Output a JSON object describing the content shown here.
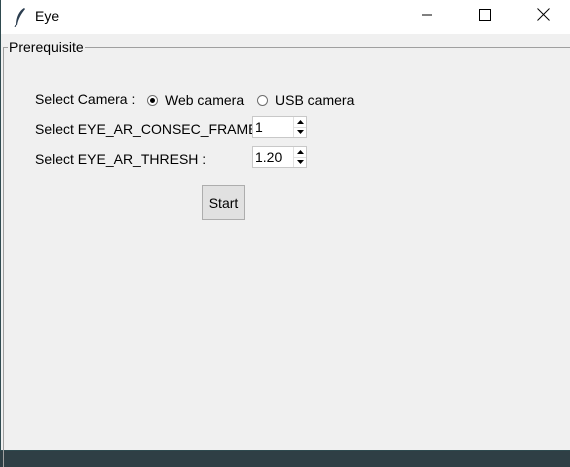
{
  "window": {
    "title": "Eye",
    "icon": "feather-icon"
  },
  "controls": {
    "minimize_icon": "minimize-icon",
    "maximize_icon": "maximize-icon",
    "close_icon": "close-icon"
  },
  "frame": {
    "label": "Prerequisite"
  },
  "camera": {
    "label": "Select Camera :",
    "options": [
      "Web camera",
      "USB camera"
    ],
    "selected": "Web camera"
  },
  "frames": {
    "label": "Select EYE_AR_CONSEC_FRAMES",
    "value": "1"
  },
  "thresh": {
    "label": "Select EYE_AR_THRESH :",
    "value": "1.20"
  },
  "start": {
    "label": "Start"
  }
}
